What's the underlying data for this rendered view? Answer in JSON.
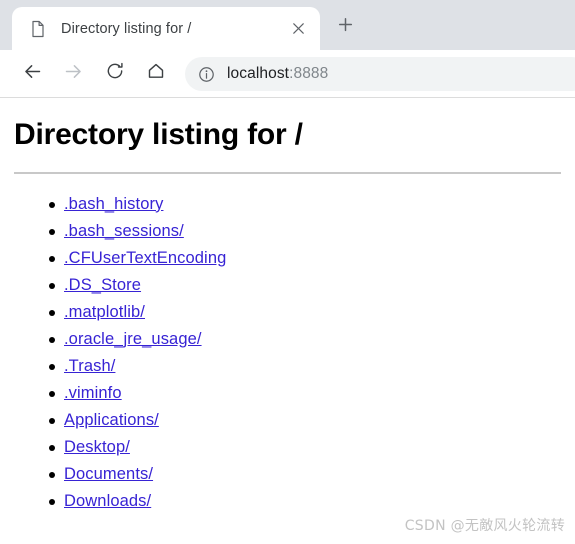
{
  "browser": {
    "tab": {
      "favicon": "document-icon",
      "title": "Directory listing for /",
      "close_label": "×"
    },
    "new_tab_label": "+",
    "toolbar": {
      "back_icon": "back-arrow-icon",
      "forward_icon": "forward-arrow-icon",
      "reload_icon": "reload-icon",
      "home_icon": "home-icon",
      "omnibox": {
        "security_icon": "info-circle-icon",
        "host": "localhost",
        "port": ":8888"
      }
    },
    "colors": {
      "tabstrip_bg": "#dee1e6",
      "tab_bg": "#ffffff",
      "toolbar_bg": "#ffffff",
      "omnibox_bg": "#f1f3f4",
      "link": "#3723d4",
      "text": "#202124"
    }
  },
  "page": {
    "title": "Directory listing for /",
    "items": [
      {
        "name": ".bash_history"
      },
      {
        "name": ".bash_sessions/"
      },
      {
        "name": ".CFUserTextEncoding"
      },
      {
        "name": ".DS_Store"
      },
      {
        "name": ".matplotlib/"
      },
      {
        "name": ".oracle_jre_usage/"
      },
      {
        "name": ".Trash/"
      },
      {
        "name": ".viminfo"
      },
      {
        "name": "Applications/"
      },
      {
        "name": "Desktop/"
      },
      {
        "name": "Documents/"
      },
      {
        "name": "Downloads/"
      }
    ]
  },
  "watermark": {
    "text": "CSDN @无敵风火轮流转"
  }
}
